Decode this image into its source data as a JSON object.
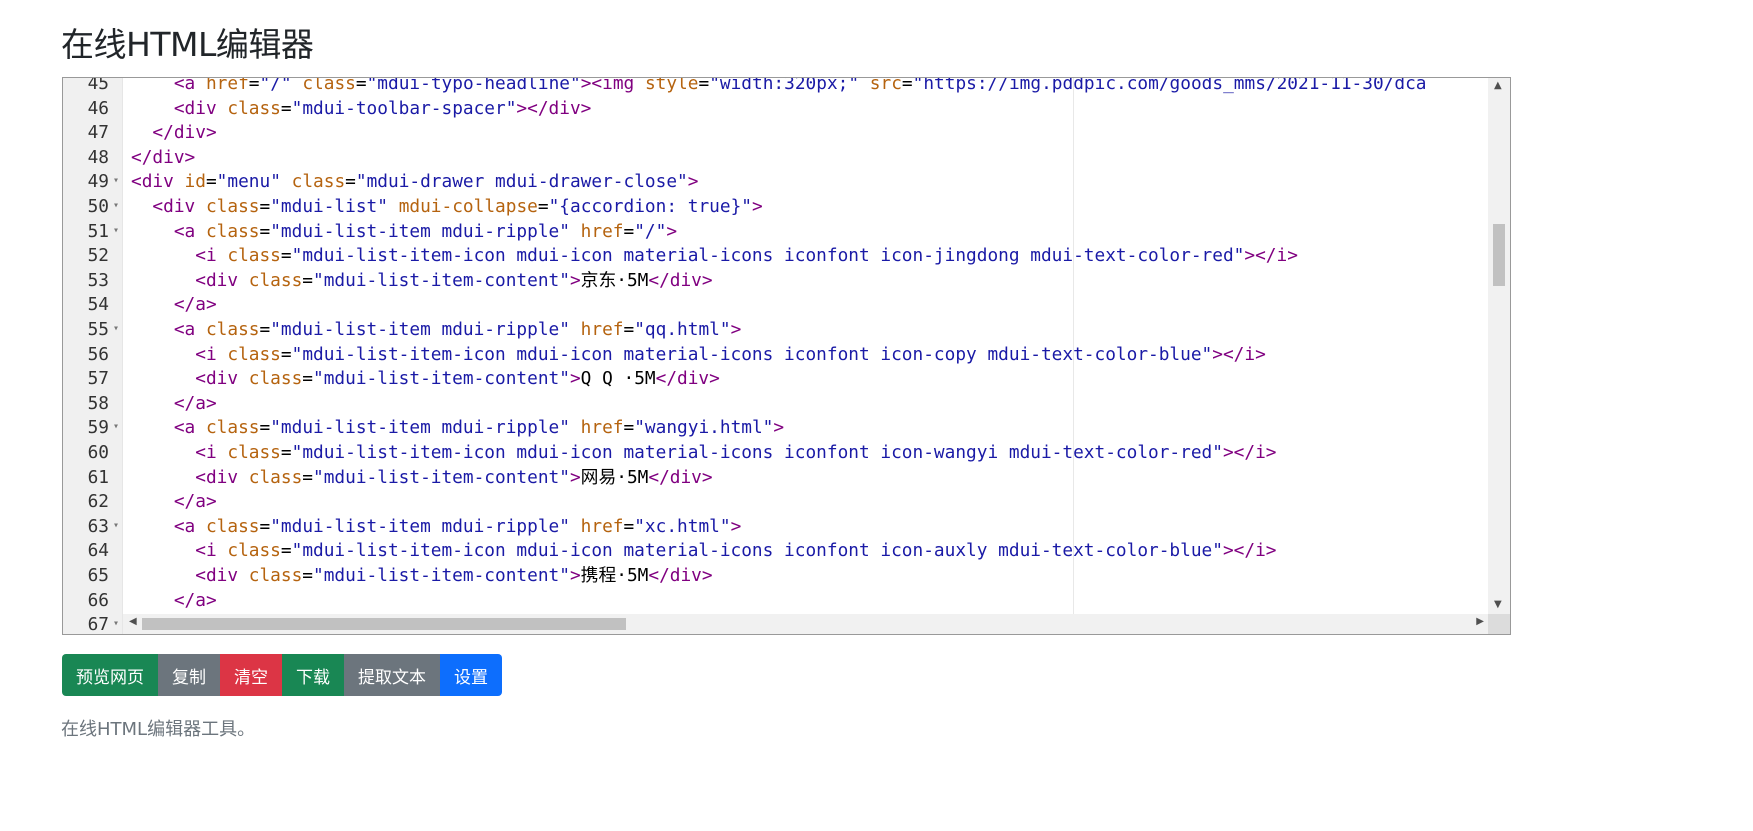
{
  "page": {
    "title": "在线HTML编辑器",
    "footer": "在线HTML编辑器工具。"
  },
  "editor": {
    "lines": [
      {
        "n": "45",
        "fold": false,
        "tokens": [
          [
            "w",
            "    "
          ],
          [
            "tag",
            "<a "
          ],
          [
            "attr",
            "href"
          ],
          [
            "txt",
            "="
          ],
          [
            "str",
            "\"/\""
          ],
          [
            "w",
            " "
          ],
          [
            "attr",
            "class"
          ],
          [
            "txt",
            "="
          ],
          [
            "str",
            "\"mdui-typo-headline\""
          ],
          [
            "tag",
            "><img "
          ],
          [
            "attr",
            "style"
          ],
          [
            "txt",
            "="
          ],
          [
            "str",
            "\"width:320px;\""
          ],
          [
            "w",
            " "
          ],
          [
            "attr",
            "src"
          ],
          [
            "txt",
            "="
          ],
          [
            "str",
            "\"https://img.pddpic.com/goods_mms/2021-11-30/dca"
          ]
        ]
      },
      {
        "n": "46",
        "fold": false,
        "tokens": [
          [
            "w",
            "    "
          ],
          [
            "tag",
            "<div "
          ],
          [
            "attr",
            "class"
          ],
          [
            "txt",
            "="
          ],
          [
            "str",
            "\"mdui-toolbar-spacer\""
          ],
          [
            "tag",
            "></div>"
          ]
        ]
      },
      {
        "n": "47",
        "fold": false,
        "tokens": [
          [
            "w",
            "  "
          ],
          [
            "tag",
            "</div>"
          ]
        ]
      },
      {
        "n": "48",
        "fold": false,
        "tokens": [
          [
            "tag",
            "</div>"
          ]
        ]
      },
      {
        "n": "49",
        "fold": true,
        "tokens": [
          [
            "tag",
            "<div "
          ],
          [
            "attr",
            "id"
          ],
          [
            "txt",
            "="
          ],
          [
            "str",
            "\"menu\""
          ],
          [
            "w",
            " "
          ],
          [
            "attr",
            "class"
          ],
          [
            "txt",
            "="
          ],
          [
            "str",
            "\"mdui-drawer mdui-drawer-close\""
          ],
          [
            "tag",
            ">"
          ]
        ]
      },
      {
        "n": "50",
        "fold": true,
        "tokens": [
          [
            "w",
            "  "
          ],
          [
            "tag",
            "<div "
          ],
          [
            "attr",
            "class"
          ],
          [
            "txt",
            "="
          ],
          [
            "str",
            "\"mdui-list\""
          ],
          [
            "w",
            " "
          ],
          [
            "attr",
            "mdui-collapse"
          ],
          [
            "txt",
            "="
          ],
          [
            "str",
            "\"{accordion: true}\""
          ],
          [
            "tag",
            ">"
          ]
        ]
      },
      {
        "n": "51",
        "fold": true,
        "tokens": [
          [
            "w",
            "    "
          ],
          [
            "tag",
            "<a "
          ],
          [
            "attr",
            "class"
          ],
          [
            "txt",
            "="
          ],
          [
            "str",
            "\"mdui-list-item mdui-ripple\""
          ],
          [
            "w",
            " "
          ],
          [
            "attr",
            "href"
          ],
          [
            "txt",
            "="
          ],
          [
            "str",
            "\"/\""
          ],
          [
            "tag",
            ">"
          ]
        ]
      },
      {
        "n": "52",
        "fold": false,
        "tokens": [
          [
            "w",
            "      "
          ],
          [
            "tag",
            "<i "
          ],
          [
            "attr",
            "class"
          ],
          [
            "txt",
            "="
          ],
          [
            "str",
            "\"mdui-list-item-icon mdui-icon material-icons iconfont icon-jingdong mdui-text-color-red\""
          ],
          [
            "tag",
            "></i>"
          ]
        ]
      },
      {
        "n": "53",
        "fold": false,
        "tokens": [
          [
            "w",
            "      "
          ],
          [
            "tag",
            "<div "
          ],
          [
            "attr",
            "class"
          ],
          [
            "txt",
            "="
          ],
          [
            "str",
            "\"mdui-list-item-content\""
          ],
          [
            "tag",
            ">"
          ],
          [
            "txt",
            "京东·5M"
          ],
          [
            "tag",
            "</div>"
          ]
        ]
      },
      {
        "n": "54",
        "fold": false,
        "tokens": [
          [
            "w",
            "    "
          ],
          [
            "tag",
            "</a>"
          ]
        ]
      },
      {
        "n": "55",
        "fold": true,
        "tokens": [
          [
            "w",
            "    "
          ],
          [
            "tag",
            "<a "
          ],
          [
            "attr",
            "class"
          ],
          [
            "txt",
            "="
          ],
          [
            "str",
            "\"mdui-list-item mdui-ripple\""
          ],
          [
            "w",
            " "
          ],
          [
            "attr",
            "href"
          ],
          [
            "txt",
            "="
          ],
          [
            "str",
            "\"qq.html\""
          ],
          [
            "tag",
            ">"
          ]
        ]
      },
      {
        "n": "56",
        "fold": false,
        "tokens": [
          [
            "w",
            "      "
          ],
          [
            "tag",
            "<i "
          ],
          [
            "attr",
            "class"
          ],
          [
            "txt",
            "="
          ],
          [
            "str",
            "\"mdui-list-item-icon mdui-icon material-icons iconfont icon-copy mdui-text-color-blue\""
          ],
          [
            "tag",
            "></i>"
          ]
        ]
      },
      {
        "n": "57",
        "fold": false,
        "tokens": [
          [
            "w",
            "      "
          ],
          [
            "tag",
            "<div "
          ],
          [
            "attr",
            "class"
          ],
          [
            "txt",
            "="
          ],
          [
            "str",
            "\"mdui-list-item-content\""
          ],
          [
            "tag",
            ">"
          ],
          [
            "txt",
            "Q Q ·5M"
          ],
          [
            "tag",
            "</div>"
          ]
        ]
      },
      {
        "n": "58",
        "fold": false,
        "tokens": [
          [
            "w",
            "    "
          ],
          [
            "tag",
            "</a>"
          ]
        ]
      },
      {
        "n": "59",
        "fold": true,
        "tokens": [
          [
            "w",
            "    "
          ],
          [
            "tag",
            "<a "
          ],
          [
            "attr",
            "class"
          ],
          [
            "txt",
            "="
          ],
          [
            "str",
            "\"mdui-list-item mdui-ripple\""
          ],
          [
            "w",
            " "
          ],
          [
            "attr",
            "href"
          ],
          [
            "txt",
            "="
          ],
          [
            "str",
            "\"wangyi.html\""
          ],
          [
            "tag",
            ">"
          ]
        ]
      },
      {
        "n": "60",
        "fold": false,
        "tokens": [
          [
            "w",
            "      "
          ],
          [
            "tag",
            "<i "
          ],
          [
            "attr",
            "class"
          ],
          [
            "txt",
            "="
          ],
          [
            "str",
            "\"mdui-list-item-icon mdui-icon material-icons iconfont icon-wangyi mdui-text-color-red\""
          ],
          [
            "tag",
            "></i>"
          ]
        ]
      },
      {
        "n": "61",
        "fold": false,
        "tokens": [
          [
            "w",
            "      "
          ],
          [
            "tag",
            "<div "
          ],
          [
            "attr",
            "class"
          ],
          [
            "txt",
            "="
          ],
          [
            "str",
            "\"mdui-list-item-content\""
          ],
          [
            "tag",
            ">"
          ],
          [
            "txt",
            "网易·5M"
          ],
          [
            "tag",
            "</div>"
          ]
        ]
      },
      {
        "n": "62",
        "fold": false,
        "tokens": [
          [
            "w",
            "    "
          ],
          [
            "tag",
            "</a>"
          ]
        ]
      },
      {
        "n": "63",
        "fold": true,
        "tokens": [
          [
            "w",
            "    "
          ],
          [
            "tag",
            "<a "
          ],
          [
            "attr",
            "class"
          ],
          [
            "txt",
            "="
          ],
          [
            "str",
            "\"mdui-list-item mdui-ripple\""
          ],
          [
            "w",
            " "
          ],
          [
            "attr",
            "href"
          ],
          [
            "txt",
            "="
          ],
          [
            "str",
            "\"xc.html\""
          ],
          [
            "tag",
            ">"
          ]
        ]
      },
      {
        "n": "64",
        "fold": false,
        "tokens": [
          [
            "w",
            "      "
          ],
          [
            "tag",
            "<i "
          ],
          [
            "attr",
            "class"
          ],
          [
            "txt",
            "="
          ],
          [
            "str",
            "\"mdui-list-item-icon mdui-icon material-icons iconfont icon-auxly mdui-text-color-blue\""
          ],
          [
            "tag",
            "></i>"
          ]
        ]
      },
      {
        "n": "65",
        "fold": false,
        "tokens": [
          [
            "w",
            "      "
          ],
          [
            "tag",
            "<div "
          ],
          [
            "attr",
            "class"
          ],
          [
            "txt",
            "="
          ],
          [
            "str",
            "\"mdui-list-item-content\""
          ],
          [
            "tag",
            ">"
          ],
          [
            "txt",
            "携程·5M"
          ],
          [
            "tag",
            "</div>"
          ]
        ]
      },
      {
        "n": "66",
        "fold": false,
        "tokens": [
          [
            "w",
            "    "
          ],
          [
            "tag",
            "</a>"
          ]
        ]
      },
      {
        "n": "67",
        "fold": true,
        "tokens": []
      }
    ]
  },
  "toolbar": {
    "preview_label": "预览网页",
    "copy_label": "复制",
    "clear_label": "清空",
    "download_label": "下载",
    "extract_label": "提取文本",
    "settings_label": "设置"
  },
  "colors": {
    "success": "#198754",
    "secondary": "#6c757d",
    "danger": "#dc3545",
    "primary": "#0d6efd",
    "tag": "#800080",
    "attribute": "#b5630f",
    "string": "#1a1aa6"
  }
}
